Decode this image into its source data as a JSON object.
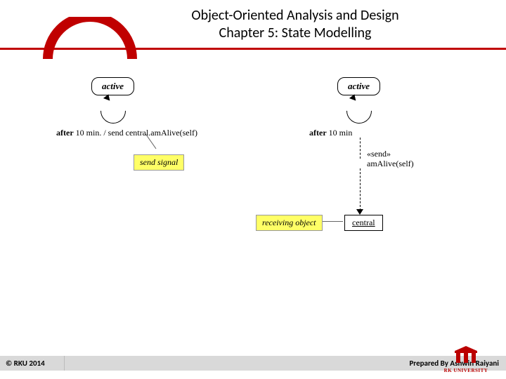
{
  "header": {
    "title_line1": "Object-Oriented Analysis and Design",
    "title_line2": "Chapter 5: State Modelling"
  },
  "diagram": {
    "left": {
      "state_label": "active",
      "transition_text": "after 10 min. / send central.amAlive(self)",
      "note_signal": "send signal"
    },
    "right": {
      "state_label": "active",
      "transition_guard": "after 10 min",
      "action_stereotype": "«send»",
      "action_call": "amAlive(self)",
      "note_receiver": "receiving object",
      "target_object": "central"
    }
  },
  "footer": {
    "copyright": "© RKU 2014",
    "author": "Prepared By Ashwin Raiyani",
    "org": "RK UNIVERSITY"
  }
}
